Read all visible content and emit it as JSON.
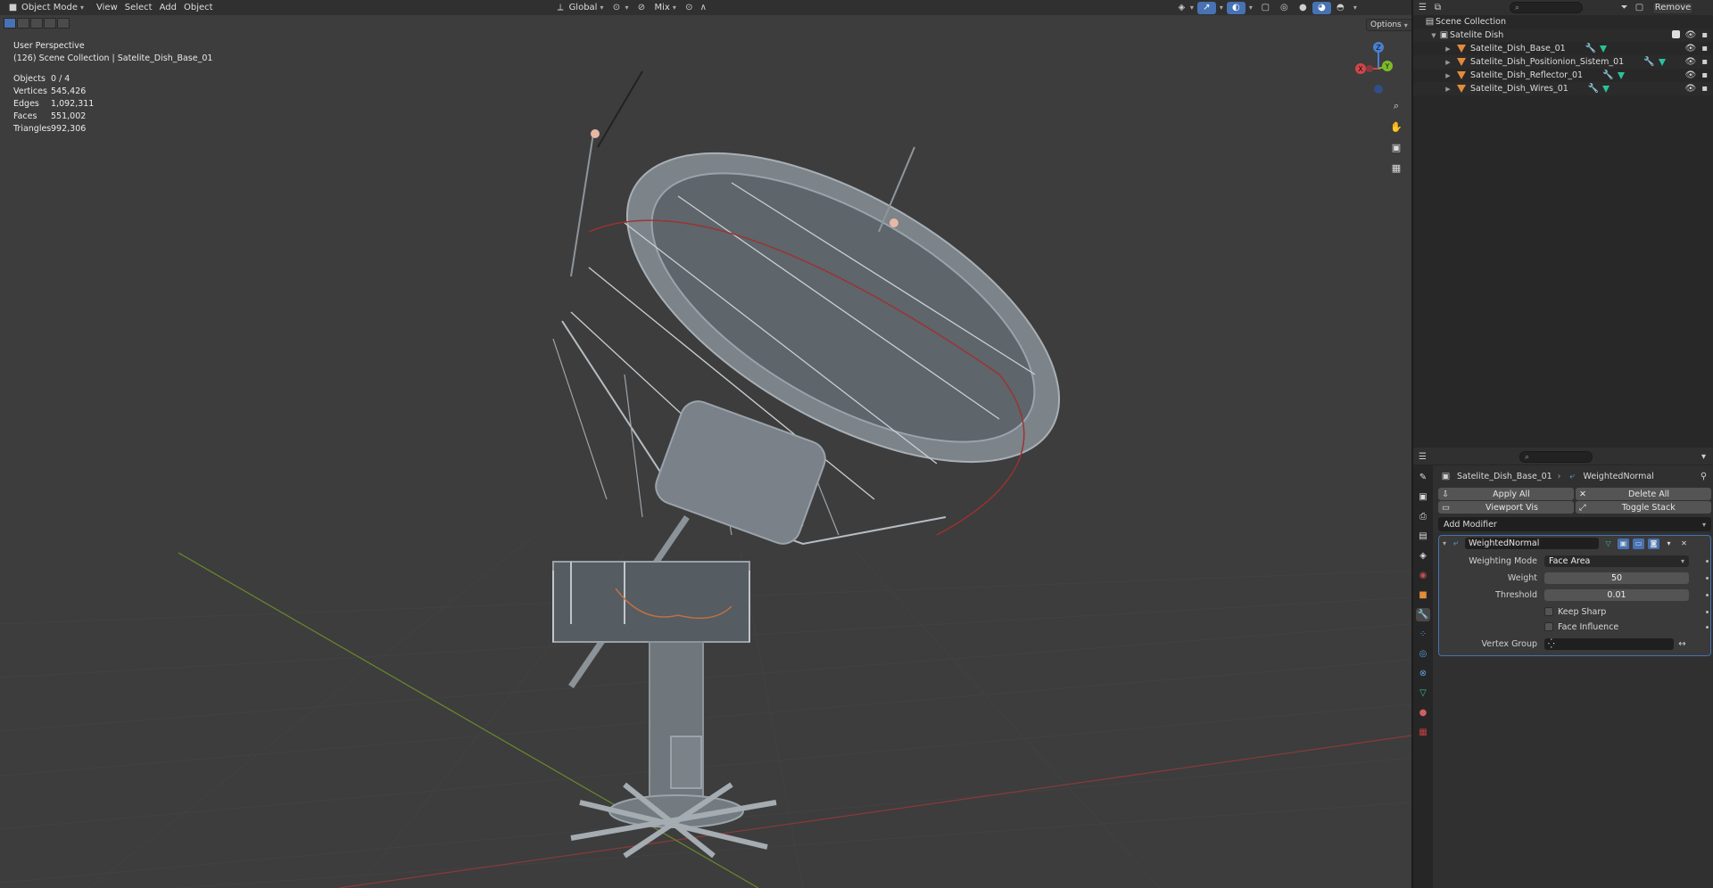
{
  "viewport_header": {
    "mode": "Object Mode",
    "menus": [
      "View",
      "Select",
      "Add",
      "Object"
    ],
    "orientation": "Global",
    "shading_mix": "Mix"
  },
  "options_label": "Options",
  "overlay": {
    "perspective": "User Perspective",
    "collection": "(126) Scene Collection | Satelite_Dish_Base_01",
    "stats": [
      {
        "label": "Objects",
        "value": "0 / 4"
      },
      {
        "label": "Vertices",
        "value": "545,426"
      },
      {
        "label": "Edges",
        "value": "1,092,311"
      },
      {
        "label": "Faces",
        "value": "551,002"
      },
      {
        "label": "Triangles",
        "value": "992,306"
      }
    ]
  },
  "gizmo": {
    "z": "Z",
    "y": "Y",
    "x": "X"
  },
  "outliner": {
    "remove_label": "Remove",
    "scene_collection": "Scene Collection",
    "collection": "Satelite Dish",
    "objects": [
      {
        "name": "Satelite_Dish_Base_01"
      },
      {
        "name": "Satelite_Dish_Positionion_Sistem_01"
      },
      {
        "name": "Satelite_Dish_Reflector_01"
      },
      {
        "name": "Satelite_Dish_Wires_01"
      }
    ]
  },
  "properties": {
    "object_name": "Satelite_Dish_Base_01",
    "modifier_crumb": "WeightedNormal",
    "apply_all": "Apply All",
    "delete_all": "Delete All",
    "viewport_vis": "Viewport Vis",
    "toggle_stack": "Toggle Stack",
    "add_modifier": "Add Modifier",
    "modifier": {
      "name": "WeightedNormal",
      "weighting_mode_label": "Weighting Mode",
      "weighting_mode_value": "Face Area",
      "weight_label": "Weight",
      "weight_value": "50",
      "threshold_label": "Threshold",
      "threshold_value": "0.01",
      "keep_sharp_label": "Keep Sharp",
      "face_influence_label": "Face Influence",
      "vertex_group_label": "Vertex Group"
    }
  },
  "colors": {
    "accent": "#4772b3",
    "object_orange": "#e28b3b",
    "mesh_teal": "#2ac29a"
  }
}
